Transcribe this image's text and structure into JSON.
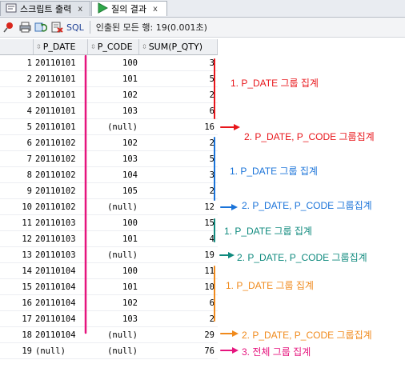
{
  "tabs": [
    {
      "label": "스크립트 출력",
      "close": "x"
    },
    {
      "label": "질의 결과",
      "close": "x"
    }
  ],
  "toolbar": {
    "icons": [
      "pin-icon",
      "print-icon",
      "refresh-icon",
      "export-icon"
    ],
    "sql_label": "SQL",
    "status": "인출된 모든 행: 19(0.001초)"
  },
  "columns": [
    "P_DATE",
    "P_CODE",
    "SUM(P_QTY)"
  ],
  "rows": [
    {
      "n": "1",
      "p_date": "20110101",
      "p_code": "100",
      "sum": "3"
    },
    {
      "n": "2",
      "p_date": "20110101",
      "p_code": "101",
      "sum": "5"
    },
    {
      "n": "3",
      "p_date": "20110101",
      "p_code": "102",
      "sum": "2"
    },
    {
      "n": "4",
      "p_date": "20110101",
      "p_code": "103",
      "sum": "6"
    },
    {
      "n": "5",
      "p_date": "20110101",
      "p_code": "(null)",
      "sum": "16"
    },
    {
      "n": "6",
      "p_date": "20110102",
      "p_code": "102",
      "sum": "2"
    },
    {
      "n": "7",
      "p_date": "20110102",
      "p_code": "103",
      "sum": "5"
    },
    {
      "n": "8",
      "p_date": "20110102",
      "p_code": "104",
      "sum": "3"
    },
    {
      "n": "9",
      "p_date": "20110102",
      "p_code": "105",
      "sum": "2"
    },
    {
      "n": "10",
      "p_date": "20110102",
      "p_code": "(null)",
      "sum": "12"
    },
    {
      "n": "11",
      "p_date": "20110103",
      "p_code": "100",
      "sum": "15"
    },
    {
      "n": "12",
      "p_date": "20110103",
      "p_code": "101",
      "sum": "4"
    },
    {
      "n": "13",
      "p_date": "20110103",
      "p_code": "(null)",
      "sum": "19"
    },
    {
      "n": "14",
      "p_date": "20110104",
      "p_code": "100",
      "sum": "11"
    },
    {
      "n": "15",
      "p_date": "20110104",
      "p_code": "101",
      "sum": "10"
    },
    {
      "n": "16",
      "p_date": "20110104",
      "p_code": "102",
      "sum": "6"
    },
    {
      "n": "17",
      "p_date": "20110104",
      "p_code": "103",
      "sum": "2"
    },
    {
      "n": "18",
      "p_date": "20110104",
      "p_code": "(null)",
      "sum": "29"
    },
    {
      "n": "19",
      "p_date": "(null)",
      "p_code": "(null)",
      "sum": "76"
    }
  ],
  "annotations": [
    {
      "text": "1. P_DATE 그룹 집계",
      "color": "#e8161b"
    },
    {
      "text": "2. P_DATE, P_CODE 그룹집계",
      "color": "#e8161b"
    },
    {
      "text": "1. P_DATE 그룹 집계",
      "color": "#1a73d9"
    },
    {
      "text": "2. P_DATE, P_CODE 그룹집계",
      "color": "#1a73d9"
    },
    {
      "text": "1. P_DATE 그룹 집계",
      "color": "#0f8a7e"
    },
    {
      "text": "2. P_DATE, P_CODE 그룹집계",
      "color": "#0f8a7e"
    },
    {
      "text": "1. P_DATE 그룹 집계",
      "color": "#f08a1c"
    },
    {
      "text": "2. P_DATE, P_CODE 그룹집계",
      "color": "#f08a1c"
    },
    {
      "text": "3. 전체 그룹 집계",
      "color": "#e6157e"
    }
  ],
  "colors": {
    "pink": "#e6157e",
    "red": "#e8161b",
    "blue": "#1a73d9",
    "teal": "#0f8a7e",
    "orange": "#f08a1c"
  }
}
